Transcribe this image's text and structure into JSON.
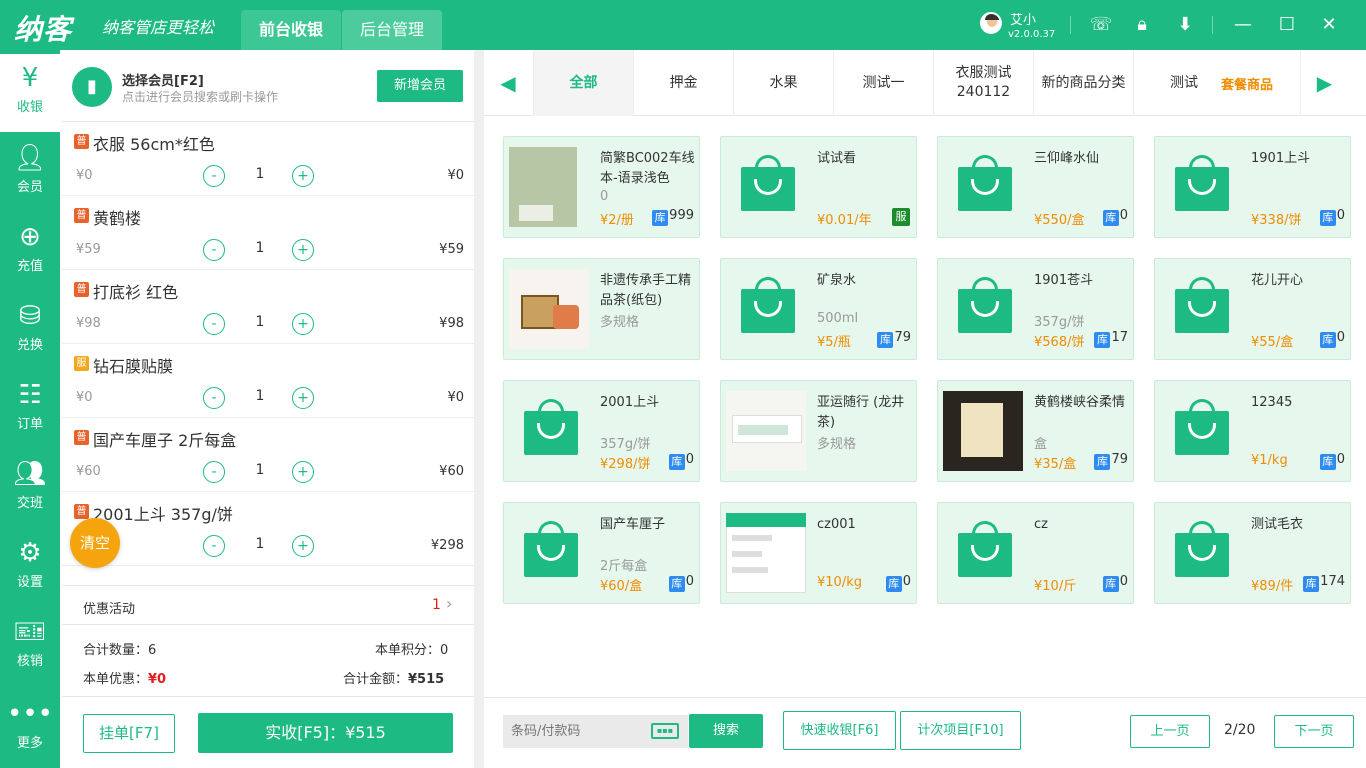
{
  "app": {
    "logo": "纳客",
    "slogan": "纳客管店更轻松",
    "tabs": [
      {
        "label": "前台收银"
      },
      {
        "label": "后台管理"
      }
    ]
  },
  "user": {
    "name": "艾小",
    "version": "v2.0.0.37"
  },
  "sidebar": {
    "items": [
      {
        "label": "收银",
        "icon": "cashier-icon"
      },
      {
        "label": "会员",
        "icon": "member-icon"
      },
      {
        "label": "充值",
        "icon": "recharge-icon"
      },
      {
        "label": "兑换",
        "icon": "exchange-icon"
      },
      {
        "label": "订单",
        "icon": "order-icon"
      },
      {
        "label": "交班",
        "icon": "handover-icon"
      },
      {
        "label": "设置",
        "icon": "gear-icon"
      },
      {
        "label": "核销",
        "icon": "ticket-icon"
      },
      {
        "label": "更多",
        "icon": "more-icon"
      }
    ]
  },
  "member": {
    "title": "选择会员[F2]",
    "subtitle": "点击进行会员搜索或刷卡操作",
    "add_label": "新增会员"
  },
  "cart": {
    "items": [
      {
        "badge": "普",
        "badge_color": "#e8622c",
        "name": "衣服 56cm*红色",
        "price": "¥0",
        "qty": "1",
        "total": "¥0"
      },
      {
        "badge": "普",
        "badge_color": "#e8622c",
        "name": "黄鹤楼",
        "price": "¥59",
        "qty": "1",
        "total": "¥59"
      },
      {
        "badge": "普",
        "badge_color": "#e8622c",
        "name": "打底衫 红色",
        "price": "¥98",
        "qty": "1",
        "total": "¥98"
      },
      {
        "badge": "服",
        "badge_color": "#f2a81a",
        "name": "钻石膜贴膜",
        "price": "¥0",
        "qty": "1",
        "total": "¥0"
      },
      {
        "badge": "普",
        "badge_color": "#e8622c",
        "name": "国产车厘子 2斤每盒",
        "price": "¥60",
        "qty": "1",
        "total": "¥60"
      },
      {
        "badge": "普",
        "badge_color": "#e8622c",
        "name": "2001上斗 357g/饼",
        "price": "",
        "qty": "1",
        "total": "¥298"
      }
    ],
    "minus": "-",
    "plus": "+",
    "clear_label": "清空"
  },
  "promo": {
    "label": "优惠活动",
    "count": "1"
  },
  "summary": {
    "qty_label": "合计数量：",
    "qty": "6",
    "points_label": "本单积分：",
    "points": "0",
    "discount_label": "本单优惠：",
    "discount": "¥0",
    "total_label": "合计金额：",
    "total": "¥515"
  },
  "actions": {
    "hold": "挂单[F7]",
    "pay": "实收[F5]：¥515"
  },
  "categories": {
    "prev": "◀",
    "next": "▶",
    "items": [
      {
        "label": "全部"
      },
      {
        "label": "押金"
      },
      {
        "label": "水果"
      },
      {
        "label": "测试一"
      },
      {
        "label": "衣服测试240112"
      },
      {
        "label": "新的商品分类"
      },
      {
        "label": "测试"
      }
    ],
    "extra": "套餐商品"
  },
  "products": [
    {
      "name": "简繁BC002车线本-语录浅色",
      "spec": "0",
      "price": "¥2/册",
      "stock_tag": "库",
      "stock": "999",
      "image": "photo"
    },
    {
      "name": "试试看",
      "spec": "",
      "price": "¥0.01/年",
      "stock_tag": "服",
      "stock": "",
      "image": "bag"
    },
    {
      "name": "三仰峰水仙",
      "spec": "",
      "price": "¥550/盒",
      "stock_tag": "库",
      "stock": "0",
      "image": "bag"
    },
    {
      "name": "1901上斗",
      "spec": "",
      "price": "¥338/饼",
      "stock_tag": "库",
      "stock": "0",
      "image": "bag"
    },
    {
      "name": "非遗传承手工精品茶(纸包)",
      "spec": "多规格",
      "price": "",
      "stock_tag": "",
      "stock": "",
      "image": "photo"
    },
    {
      "name": "矿泉水",
      "spec": "500ml",
      "price": "¥5/瓶",
      "stock_tag": "库",
      "stock": "79",
      "image": "bag"
    },
    {
      "name": "1901苍斗",
      "spec": "357g/饼",
      "price": "¥568/饼",
      "stock_tag": "库",
      "stock": "17",
      "image": "bag"
    },
    {
      "name": "花儿开心",
      "spec": "",
      "price": "¥55/盒",
      "stock_tag": "库",
      "stock": "0",
      "image": "bag"
    },
    {
      "name": "2001上斗",
      "spec": "357g/饼",
      "price": "¥298/饼",
      "stock_tag": "库",
      "stock": "0",
      "image": "bag"
    },
    {
      "name": "亚运随行 (龙井茶)",
      "spec": "多规格",
      "price": "",
      "stock_tag": "",
      "stock": "",
      "image": "photo"
    },
    {
      "name": "黄鹤楼峡谷柔情",
      "spec": "盒",
      "price": "¥35/盒",
      "stock_tag": "库",
      "stock": "79",
      "image": "photo"
    },
    {
      "name": "12345",
      "spec": "",
      "price": "¥1/kg",
      "stock_tag": "库",
      "stock": "0",
      "image": "bag"
    },
    {
      "name": "国产车厘子",
      "spec": "2斤每盒",
      "price": "¥60/盒",
      "stock_tag": "库",
      "stock": "0",
      "image": "bag"
    },
    {
      "name": "cz001",
      "spec": "",
      "price": "¥10/kg",
      "stock_tag": "库",
      "stock": "0",
      "image": "photo"
    },
    {
      "name": "cz",
      "spec": "",
      "price": "¥10/斤",
      "stock_tag": "库",
      "stock": "0",
      "image": "bag"
    },
    {
      "name": "测试毛衣",
      "spec": "",
      "price": "¥89/件",
      "stock_tag": "库",
      "stock": "174",
      "image": "bag"
    }
  ],
  "bottom": {
    "search_placeholder": "条码/付款码",
    "search_btn": "搜索",
    "quick": "快速收银[F6]",
    "count_item": "计次项目[F10]",
    "prev": "上一页",
    "page": "2/20",
    "next": "下一页"
  },
  "colors": {
    "brand": "#1dba83",
    "price": "#f08c00",
    "stock_tag": "#2f8bf0",
    "discount": "#e02020"
  }
}
